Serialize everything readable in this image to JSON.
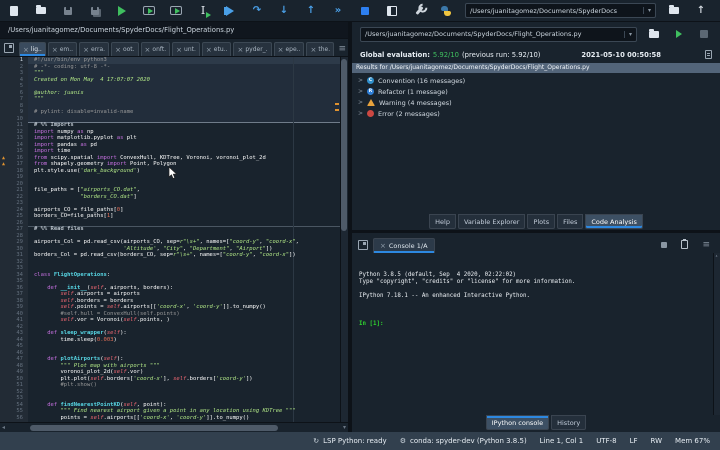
{
  "toolbar": {
    "workdir": "/Users/juanitagomez/Documents/SpyderDocs",
    "icon_names": [
      "new-file",
      "open-file",
      "save",
      "save-all",
      "run",
      "run-cell",
      "run-cell-advance",
      "run-selection",
      "debug",
      "debug-continue",
      "step-into",
      "step-return",
      "fast-forward",
      "stop",
      "maximize-pane",
      "preferences",
      "python-env",
      "workdir-combo",
      "browse-folder",
      "parent-directory"
    ]
  },
  "icons": {
    "close": "×",
    "debug_continue": "↷",
    "step_into": "↓",
    "step_return": "↑",
    "fast_forward": "»",
    "parent_dir": "↑",
    "chevron": ">",
    "dropdown": "▾",
    "hamburger": "≡",
    "left_arrow": "◂",
    "up_small": "▴",
    "lsp": "↻",
    "conda": "⚙"
  },
  "editor": {
    "path": "/Users/juanitagomez/Documents/SpyderDocs/Flight_Operations.py",
    "tabs": [
      {
        "label": "lig..",
        "active": true
      },
      {
        "label": "em..",
        "active": false
      },
      {
        "label": "erra.",
        "active": false
      },
      {
        "label": "oot.",
        "active": false
      },
      {
        "label": "onft.",
        "active": false
      },
      {
        "label": "unt.",
        "active": false
      },
      {
        "label": "etu..",
        "active": false
      },
      {
        "label": "pyder_.",
        "active": false
      },
      {
        "label": "epe..",
        "active": false
      },
      {
        "label": "the.",
        "active": false
      }
    ],
    "current_line": 1,
    "warning_lines": [
      16,
      17
    ],
    "lines": [
      [
        [
          "c",
          "#!/usr/bin/env python3"
        ]
      ],
      [
        [
          "c",
          "# -*- coding: utf-8 -*-"
        ]
      ],
      [
        [
          "s",
          "\"\"\""
        ]
      ],
      [
        [
          "s",
          "Created on Mon May  4 17:07:07 2020"
        ]
      ],
      [],
      [
        [
          "s",
          "@author: juanis"
        ]
      ],
      [
        [
          "s",
          "\"\"\""
        ]
      ],
      [],
      [
        [
          "c",
          "# pylint: disable=invalid-name"
        ]
      ],
      [],
      [
        [
          "cc",
          "# %% Imports"
        ]
      ],
      [
        [
          "k",
          "import "
        ],
        [
          "n",
          "numpy "
        ],
        [
          "k",
          "as "
        ],
        [
          "n",
          "np"
        ]
      ],
      [
        [
          "k",
          "import "
        ],
        [
          "n",
          "matplotlib.pyplot "
        ],
        [
          "k",
          "as "
        ],
        [
          "n",
          "plt"
        ]
      ],
      [
        [
          "k",
          "import "
        ],
        [
          "n",
          "pandas "
        ],
        [
          "k",
          "as "
        ],
        [
          "n",
          "pd"
        ]
      ],
      [
        [
          "k",
          "import "
        ],
        [
          "n",
          "time"
        ]
      ],
      [
        [
          "k",
          "from "
        ],
        [
          "n",
          "scipy.spatial "
        ],
        [
          "k",
          "import "
        ],
        [
          "n",
          "ConvexHull, KDTree, Voronoi, voronoi_plot_2d"
        ]
      ],
      [
        [
          "k",
          "from "
        ],
        [
          "n",
          "shapely.geometry "
        ],
        [
          "k",
          "import "
        ],
        [
          "n",
          "Point, Polygon"
        ]
      ],
      [
        [
          "n",
          "plt.style.use("
        ],
        [
          "s",
          "'dark_background'"
        ],
        [
          "n",
          ")"
        ]
      ],
      [],
      [],
      [
        [
          "n",
          "file_paths = ["
        ],
        [
          "s",
          "\"airports_CO.dat\""
        ],
        [
          "n",
          ","
        ]
      ],
      [
        [
          "n",
          "              "
        ],
        [
          "s",
          "\"borders_CO.dat\""
        ],
        [
          "n",
          "]"
        ]
      ],
      [],
      [
        [
          "n",
          "airports_CO = file_paths["
        ],
        [
          "m",
          "0"
        ],
        [
          "n",
          "]"
        ]
      ],
      [
        [
          "n",
          "borders_CO=file_paths["
        ],
        [
          "m",
          "1"
        ],
        [
          "n",
          "]"
        ]
      ],
      [],
      [
        [
          "cc",
          "# %% Read files"
        ]
      ],
      [],
      [
        [
          "n",
          "airports_Col = pd.read_csv(airports_CO, sep="
        ],
        [
          "s",
          "r\"\\s+\""
        ],
        [
          "n",
          ", names=["
        ],
        [
          "s",
          "\"coord-y\""
        ],
        [
          "n",
          ", "
        ],
        [
          "s",
          "\"coord-x\""
        ],
        [
          "n",
          ","
        ]
      ],
      [
        [
          "n",
          "                           "
        ],
        [
          "s",
          "'Altitude'"
        ],
        [
          "n",
          ", "
        ],
        [
          "s",
          "\"City\""
        ],
        [
          "n",
          ", "
        ],
        [
          "s",
          "\"Department\""
        ],
        [
          "n",
          ", "
        ],
        [
          "s",
          "\"Airport\""
        ],
        [
          "n",
          "])"
        ]
      ],
      [
        [
          "n",
          "borders_Col = pd.read_csv(borders_CO, sep="
        ],
        [
          "s",
          "r\"\\s+\""
        ],
        [
          "n",
          ", names=["
        ],
        [
          "s",
          "\"coord-y\""
        ],
        [
          "n",
          ", "
        ],
        [
          "s",
          "\"coord-x\""
        ],
        [
          "n",
          "])"
        ]
      ],
      [],
      [],
      [
        [
          "k",
          "class "
        ],
        [
          "d",
          "FlightOperations"
        ],
        [
          "n",
          ":"
        ]
      ],
      [],
      [
        [
          "n",
          "    "
        ],
        [
          "k",
          "def "
        ],
        [
          "d",
          "__init__"
        ],
        [
          "n",
          "("
        ],
        [
          "i",
          "self"
        ],
        [
          "n",
          ", airports, borders):"
        ]
      ],
      [
        [
          "n",
          "        "
        ],
        [
          "i",
          "self"
        ],
        [
          "n",
          ".airports = airports"
        ]
      ],
      [
        [
          "n",
          "        "
        ],
        [
          "i",
          "self"
        ],
        [
          "n",
          ".borders = borders"
        ]
      ],
      [
        [
          "n",
          "        "
        ],
        [
          "i",
          "self"
        ],
        [
          "n",
          ".points = "
        ],
        [
          "i",
          "self"
        ],
        [
          "n",
          ".airports[["
        ],
        [
          "s",
          "'coord-x'"
        ],
        [
          "n",
          ", "
        ],
        [
          "s",
          "'coord-y'"
        ],
        [
          "n",
          "]].to_numpy()"
        ]
      ],
      [
        [
          "n",
          "        "
        ],
        [
          "c",
          "#self.hull = ConvexHull(self.points)"
        ]
      ],
      [
        [
          "n",
          "        "
        ],
        [
          "i",
          "self"
        ],
        [
          "n",
          ".vor = Voronoi("
        ],
        [
          "i",
          "self"
        ],
        [
          "n",
          ".points, )"
        ]
      ],
      [],
      [
        [
          "n",
          "    "
        ],
        [
          "k",
          "def "
        ],
        [
          "d",
          "sleep_wrapper"
        ],
        [
          "n",
          "("
        ],
        [
          "i",
          "self"
        ],
        [
          "n",
          "):"
        ]
      ],
      [
        [
          "n",
          "        time.sleep("
        ],
        [
          "m",
          "0.003"
        ],
        [
          "n",
          ")"
        ]
      ],
      [],
      [],
      [
        [
          "n",
          "    "
        ],
        [
          "k",
          "def "
        ],
        [
          "d",
          "plotAirports"
        ],
        [
          "n",
          "("
        ],
        [
          "i",
          "self"
        ],
        [
          "n",
          "):"
        ]
      ],
      [
        [
          "n",
          "        "
        ],
        [
          "s",
          "\"\"\" Plot map with airports \"\"\""
        ]
      ],
      [
        [
          "n",
          "        voronoi_plot_2d("
        ],
        [
          "i",
          "self"
        ],
        [
          "n",
          ".vor)"
        ]
      ],
      [
        [
          "n",
          "        plt.plot("
        ],
        [
          "i",
          "self"
        ],
        [
          "n",
          ".borders["
        ],
        [
          "s",
          "'coord-x'"
        ],
        [
          "n",
          "], "
        ],
        [
          "i",
          "self"
        ],
        [
          "n",
          ".borders["
        ],
        [
          "s",
          "'coord-y'"
        ],
        [
          "n",
          "])"
        ]
      ],
      [
        [
          "n",
          "        "
        ],
        [
          "c",
          "#plt.show()"
        ]
      ],
      [],
      [],
      [
        [
          "n",
          "    "
        ],
        [
          "k",
          "def "
        ],
        [
          "d",
          "findNearestPointKD"
        ],
        [
          "n",
          "("
        ],
        [
          "i",
          "self"
        ],
        [
          "n",
          ", point):"
        ]
      ],
      [
        [
          "n",
          "        "
        ],
        [
          "s",
          "\"\"\" Find nearest airport given a point in any location using KDTree \"\"\""
        ]
      ],
      [
        [
          "n",
          "        points = "
        ],
        [
          "i",
          "self"
        ],
        [
          "n",
          ".airports[["
        ],
        [
          "s",
          "'coord-x'"
        ],
        [
          "n",
          ", "
        ],
        [
          "s",
          "'coord-y'"
        ],
        [
          "n",
          "]].to_numpy()"
        ]
      ]
    ]
  },
  "analysis": {
    "path": "/Users/juanitagomez/Documents/SpyderDocs/Flight_Operations.py",
    "eval_label": "Global evaluation:",
    "score": "5.92/10",
    "previous": "(previous run: 5.92/10)",
    "timestamp": "2021-05-10 00:50:58",
    "results_header": "Results for /Users/juanitagomez/Documents/SpyderDocs/Flight_Operations.py",
    "items": [
      {
        "kind": "convention",
        "letter": "C",
        "label": "Convention (16 messages)"
      },
      {
        "kind": "refactor",
        "letter": "R",
        "label": "Refactor (1 message)"
      },
      {
        "kind": "warning",
        "letter": "",
        "label": "Warning (4 messages)"
      },
      {
        "kind": "error",
        "letter": "",
        "label": "Error (2 messages)"
      }
    ],
    "tabs": [
      {
        "label": "Help",
        "active": false
      },
      {
        "label": "Variable Explorer",
        "active": false
      },
      {
        "label": "Plots",
        "active": false
      },
      {
        "label": "Files",
        "active": false
      },
      {
        "label": "Code Analysis",
        "active": true
      }
    ]
  },
  "console": {
    "tab_label": "Console 1/A",
    "lines": [
      "Python 3.8.5 (default, Sep  4 2020, 02:22:02)",
      "Type \"copyright\", \"credits\" or \"license\" for more information.",
      "",
      "IPython 7.18.1 -- An enhanced Interactive Python.",
      ""
    ],
    "prompt": "In [1]:",
    "tabs": [
      {
        "label": "IPython console",
        "active": true
      },
      {
        "label": "History",
        "active": false
      }
    ]
  },
  "statusbar": {
    "lsp": "LSP Python: ready",
    "conda": "conda: spyder-dev (Python 3.8.5)",
    "cursor": "Line 1, Col 1",
    "encoding": "UTF-8",
    "eol": "LF",
    "permissions": "RW",
    "memory": "Mem 67%"
  },
  "colors": {
    "accent_blue": "#2d88e0",
    "run_green": "#3fbf5f",
    "debug_blue": "#4aa0e8",
    "warning_orange": "#e0922f",
    "error_red": "#cc4842",
    "score_green": "#3fbf5f",
    "background": "#19232d"
  }
}
